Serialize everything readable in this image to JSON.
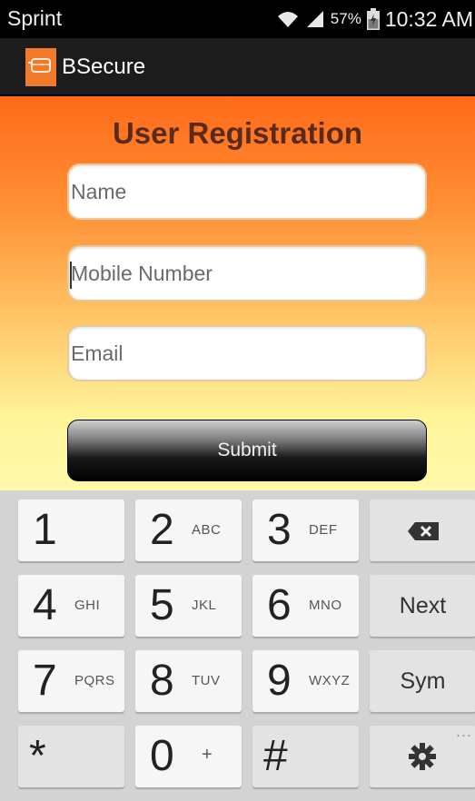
{
  "status_bar": {
    "carrier": "Sprint",
    "battery_percent": "57%",
    "time": "10:32 AM"
  },
  "app_bar": {
    "title": "BSecure",
    "icon": "app-icon"
  },
  "form": {
    "title": "User Registration",
    "name_placeholder": "Name",
    "mobile_placeholder": "Mobile Number",
    "email_placeholder": "Email",
    "submit_label": "Submit"
  },
  "keyboard": {
    "rows": [
      [
        {
          "main": "1",
          "sub": ""
        },
        {
          "main": "2",
          "sub": "ABC"
        },
        {
          "main": "3",
          "sub": "DEF"
        },
        {
          "icon": "backspace-icon"
        }
      ],
      [
        {
          "main": "4",
          "sub": "GHI"
        },
        {
          "main": "5",
          "sub": "JKL"
        },
        {
          "main": "6",
          "sub": "MNO"
        },
        {
          "word": "Next"
        }
      ],
      [
        {
          "main": "7",
          "sub": "PQRS"
        },
        {
          "main": "8",
          "sub": "TUV"
        },
        {
          "main": "9",
          "sub": "WXYZ"
        },
        {
          "word": "Sym"
        }
      ],
      [
        {
          "main": "*",
          "sub": ""
        },
        {
          "main": "0",
          "sub": "+"
        },
        {
          "main": "#",
          "sub": ""
        },
        {
          "icon": "settings-gear-icon",
          "extra": "..."
        }
      ]
    ]
  },
  "colors": {
    "gradient_top": "#ff6a1a",
    "gradient_bottom": "#fff9aa",
    "title_color": "#5a2a1a",
    "app_icon_color": "#f07a2a"
  }
}
